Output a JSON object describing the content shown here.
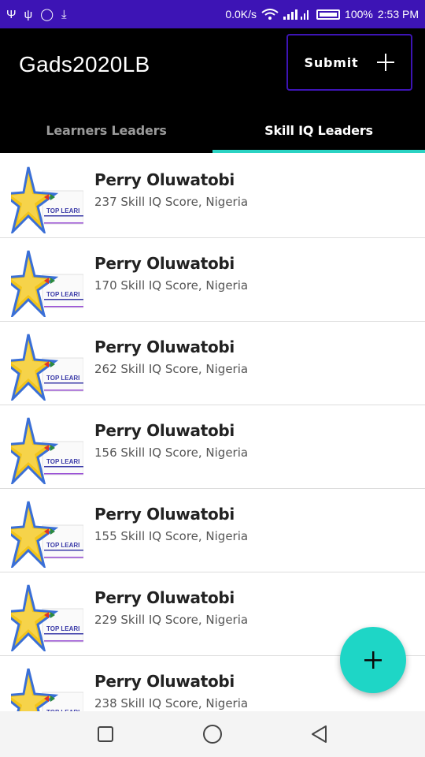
{
  "status_bar": {
    "left_icons": [
      "usb-icon",
      "usb-alt-icon",
      "chat-icon",
      "download-icon"
    ],
    "left_glyphs": [
      "Ψ",
      "ψ",
      "◯",
      "⤓"
    ],
    "speed": "0.0K/s",
    "battery": "100%",
    "time": "2:53 PM"
  },
  "app_bar": {
    "title": "Gads2020LB",
    "submit_label": "Submit",
    "submit_icon": "plus-icon",
    "tabs": [
      {
        "label": "Learners Leaders",
        "active": false
      },
      {
        "label": "Skill IQ Leaders",
        "active": true
      }
    ],
    "colors": {
      "accent": "#3d14b5",
      "tab_indicator": "#2bd3c3",
      "fab": "#1ed6c6"
    }
  },
  "leaders": [
    {
      "name": "Perry Oluwatobi",
      "detail": "237 Skill IQ Score, Nigeria"
    },
    {
      "name": "Perry Oluwatobi",
      "detail": "170 Skill IQ Score, Nigeria"
    },
    {
      "name": "Perry Oluwatobi",
      "detail": "262 Skill IQ Score, Nigeria"
    },
    {
      "name": "Perry Oluwatobi",
      "detail": "156 Skill IQ Score, Nigeria"
    },
    {
      "name": "Perry Oluwatobi",
      "detail": "155 Skill IQ Score, Nigeria"
    },
    {
      "name": "Perry Oluwatobi",
      "detail": "229 Skill IQ Score, Nigeria"
    },
    {
      "name": "Perry Oluwatobi",
      "detail": "238 Skill IQ Score, Nigeria"
    }
  ],
  "badge_text": "TOP LEARI",
  "fab": {
    "icon": "plus-icon"
  },
  "nav_bar": {
    "icons": [
      "recent-apps-icon",
      "home-icon",
      "back-icon"
    ]
  }
}
